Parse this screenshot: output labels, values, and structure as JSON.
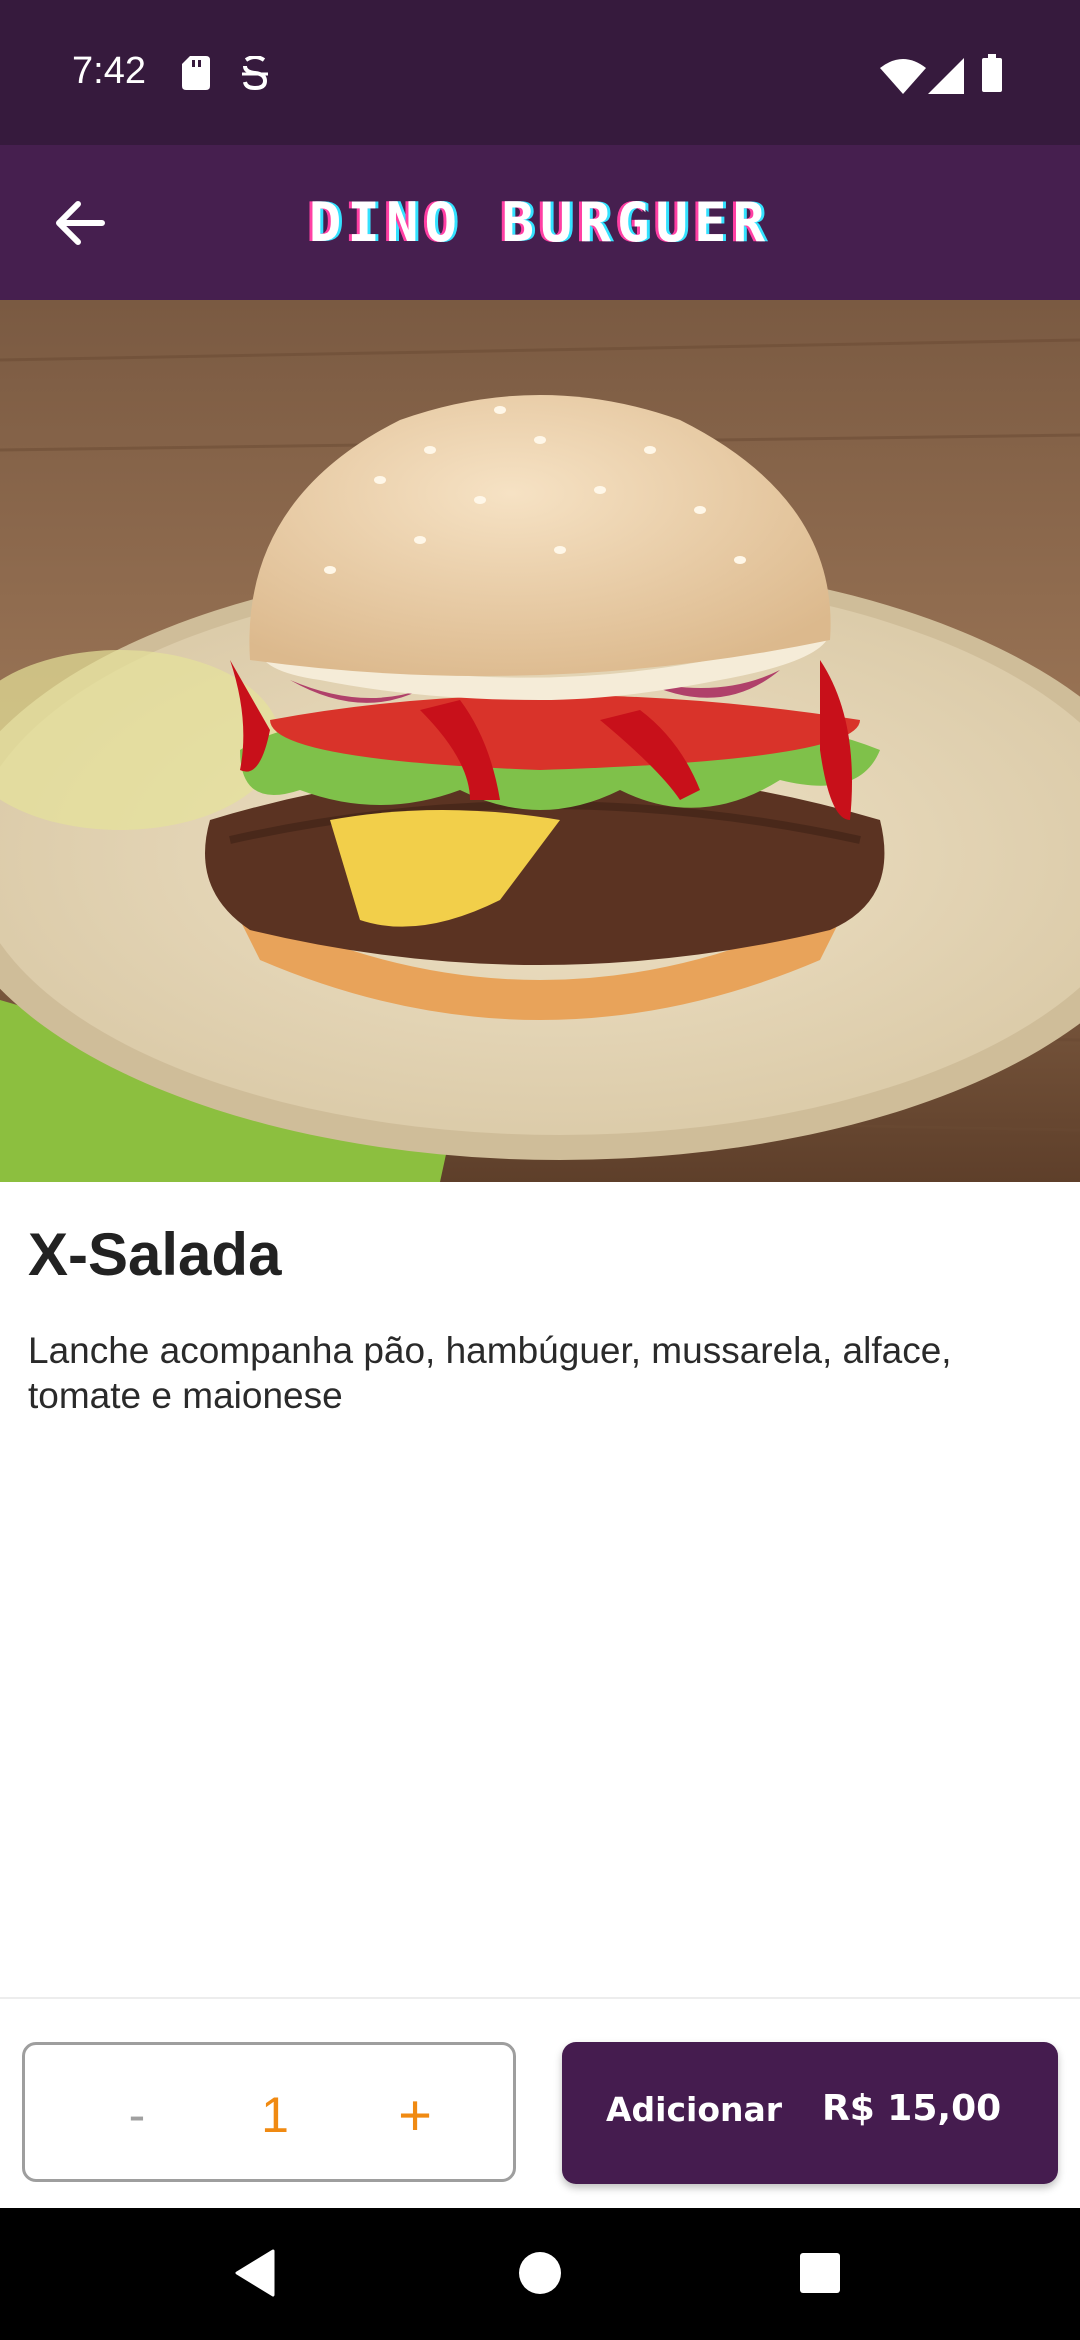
{
  "status_bar": {
    "time": "7:42",
    "icons": [
      "sd-card-icon",
      "s-notification-icon",
      "wifi-icon",
      "signal-icon",
      "battery-icon"
    ]
  },
  "app_bar": {
    "title": "DINO BURGUER",
    "back_icon": "arrow-left-icon"
  },
  "product": {
    "name": "X-Salada",
    "description": "Lanche acompanha pão, hambúguer, mussarela, alface, tomate e maionese"
  },
  "quantity": {
    "decrement_label": "-",
    "value": "1",
    "increment_label": "+"
  },
  "add_button": {
    "label": "Adicionar",
    "price": "R$ 15,00"
  },
  "colors": {
    "status_bar": "#361a3d",
    "app_bar": "#461f4f",
    "accent": "#f08a12",
    "add_button": "#451c4f"
  },
  "nav_bar": {
    "icons": [
      "back-triangle-icon",
      "home-circle-icon",
      "recents-square-icon"
    ]
  }
}
